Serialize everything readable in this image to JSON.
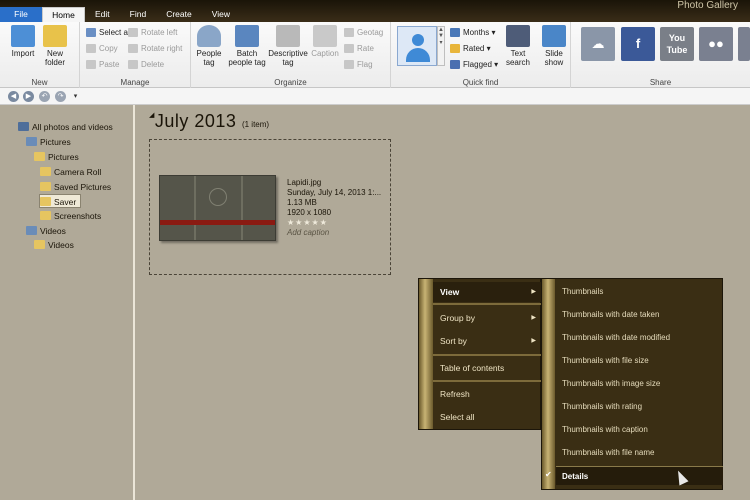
{
  "window": {
    "title": "Photo Gallery"
  },
  "menu_tabs": [
    "File",
    "Home",
    "Edit",
    "Find",
    "Create",
    "View"
  ],
  "ribbon": {
    "new": {
      "title": "New",
      "import": "Import",
      "new_folder": "New folder"
    },
    "manage": {
      "title": "Manage",
      "select_all": "Select all",
      "copy": "Copy",
      "paste": "Paste",
      "rotate_left": "Rotate left",
      "rotate_right": "Rotate right",
      "delete": "Delete"
    },
    "organize": {
      "title": "Organize",
      "people_tag": "People tag",
      "batch_people_tag": "Batch people tag",
      "descriptive_tag": "Descriptive tag",
      "caption": "Caption",
      "geotag": "Geotag",
      "rate": "Rate",
      "flag": "Flag"
    },
    "quick_find": {
      "title": "Quick find",
      "months": "Months",
      "rated": "Rated",
      "flagged": "Flagged",
      "text_search": "Text search",
      "slide_show": "Slide show"
    },
    "share": {
      "title": "Share"
    }
  },
  "tree": {
    "items": [
      {
        "label": "All photos and videos"
      },
      {
        "label": "Pictures"
      },
      {
        "label": "Pictures"
      },
      {
        "label": "Camera Roll"
      },
      {
        "label": "Saved Pictures"
      },
      {
        "label": "Saver"
      },
      {
        "label": "Screenshots"
      },
      {
        "label": "Videos"
      },
      {
        "label": "Videos"
      }
    ]
  },
  "main": {
    "group_title": "July 2013",
    "group_count": "(1 item)",
    "photo": {
      "filename": "Lapidi.jpg",
      "date": "Sunday, July 14, 2013 1:...",
      "size": "1.13 MB",
      "dimensions": "1920 x 1080",
      "stars": "★★★★★",
      "caption_placeholder": "Add caption"
    }
  },
  "context_menu": {
    "items": [
      "View",
      "Group by",
      "Sort by",
      "Table of contents",
      "Refresh",
      "Select all"
    ]
  },
  "view_submenu": {
    "items": [
      "Thumbnails",
      "Thumbnails with date taken",
      "Thumbnails with date modified",
      "Thumbnails with file size",
      "Thumbnails with image size",
      "Thumbnails with rating",
      "Thumbnails with caption",
      "Thumbnails with file name",
      "Details"
    ],
    "checked": "Details"
  },
  "colors": {
    "file_tab": "#2a6fc9",
    "menu_bg": "#3a2e14",
    "menu_text": "#efe4c4",
    "tree_bg": "#b0a998"
  }
}
